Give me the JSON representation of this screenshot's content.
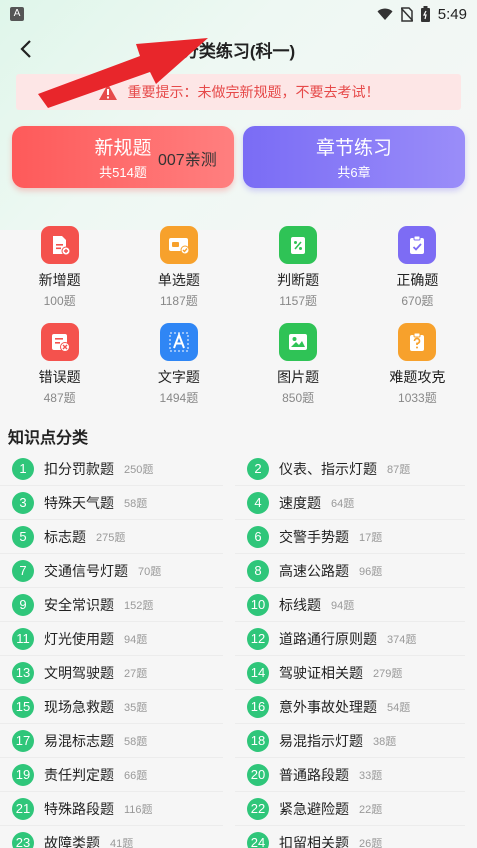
{
  "status_bar": {
    "app_badge": "A",
    "time": "5:49"
  },
  "header": {
    "title": "分类练习(科一)"
  },
  "notice": {
    "text": "重要提示：未做完新规题，不要去考试！"
  },
  "cards": [
    {
      "title": "新规题",
      "sub": "共514题"
    },
    {
      "title": "章节练习",
      "sub": "共6章"
    }
  ],
  "card_overlay": "007亲测",
  "grid": [
    {
      "label": "新增题",
      "count": "100题",
      "icon": "doc-plus-icon",
      "color": "#f4524d"
    },
    {
      "label": "单选题",
      "count": "1187题",
      "icon": "card-check-icon",
      "color": "#f7a12c"
    },
    {
      "label": "判断题",
      "count": "1157题",
      "icon": "percent-doc-icon",
      "color": "#2fc356"
    },
    {
      "label": "正确题",
      "count": "670题",
      "icon": "check-doc-icon",
      "color": "#7d6cf4"
    },
    {
      "label": "错误题",
      "count": "487题",
      "icon": "error-list-icon",
      "color": "#f4524d"
    },
    {
      "label": "文字题",
      "count": "1494题",
      "icon": "text-a-icon",
      "color": "#2f86f5"
    },
    {
      "label": "图片题",
      "count": "850题",
      "icon": "image-icon",
      "color": "#2fc356"
    },
    {
      "label": "难题攻克",
      "count": "1033题",
      "icon": "question-icon",
      "color": "#f7a12c"
    }
  ],
  "section_title": "知识点分类",
  "knowledge_points": [
    {
      "num": "1",
      "name": "扣分罚款题",
      "count": "250题"
    },
    {
      "num": "2",
      "name": "仪表、指示灯题",
      "count": "87题"
    },
    {
      "num": "3",
      "name": "特殊天气题",
      "count": "58题"
    },
    {
      "num": "4",
      "name": "速度题",
      "count": "64题"
    },
    {
      "num": "5",
      "name": "标志题",
      "count": "275题"
    },
    {
      "num": "6",
      "name": "交警手势题",
      "count": "17题"
    },
    {
      "num": "7",
      "name": "交通信号灯题",
      "count": "70题"
    },
    {
      "num": "8",
      "name": "高速公路题",
      "count": "96题"
    },
    {
      "num": "9",
      "name": "安全常识题",
      "count": "152题"
    },
    {
      "num": "10",
      "name": "标线题",
      "count": "94题"
    },
    {
      "num": "11",
      "name": "灯光使用题",
      "count": "94题"
    },
    {
      "num": "12",
      "name": "道路通行原则题",
      "count": "374题"
    },
    {
      "num": "13",
      "name": "文明驾驶题",
      "count": "27题"
    },
    {
      "num": "14",
      "name": "驾驶证相关题",
      "count": "279题"
    },
    {
      "num": "15",
      "name": "现场急救题",
      "count": "35题"
    },
    {
      "num": "16",
      "name": "意外事故处理题",
      "count": "54题"
    },
    {
      "num": "17",
      "name": "易混标志题",
      "count": "58题"
    },
    {
      "num": "18",
      "name": "易混指示灯题",
      "count": "38题"
    },
    {
      "num": "19",
      "name": "责任判定题",
      "count": "66题"
    },
    {
      "num": "20",
      "name": "普通路段题",
      "count": "33题"
    },
    {
      "num": "21",
      "name": "特殊路段题",
      "count": "116题"
    },
    {
      "num": "22",
      "name": "紧急避险题",
      "count": "22题"
    },
    {
      "num": "23",
      "name": "故障类题",
      "count": "41题"
    },
    {
      "num": "24",
      "name": "扣留相关题",
      "count": "26题"
    }
  ],
  "colors": {
    "accent_green": "#2fc67a",
    "notice_red": "#e64a4a",
    "annotation_red": "#e8262b"
  }
}
